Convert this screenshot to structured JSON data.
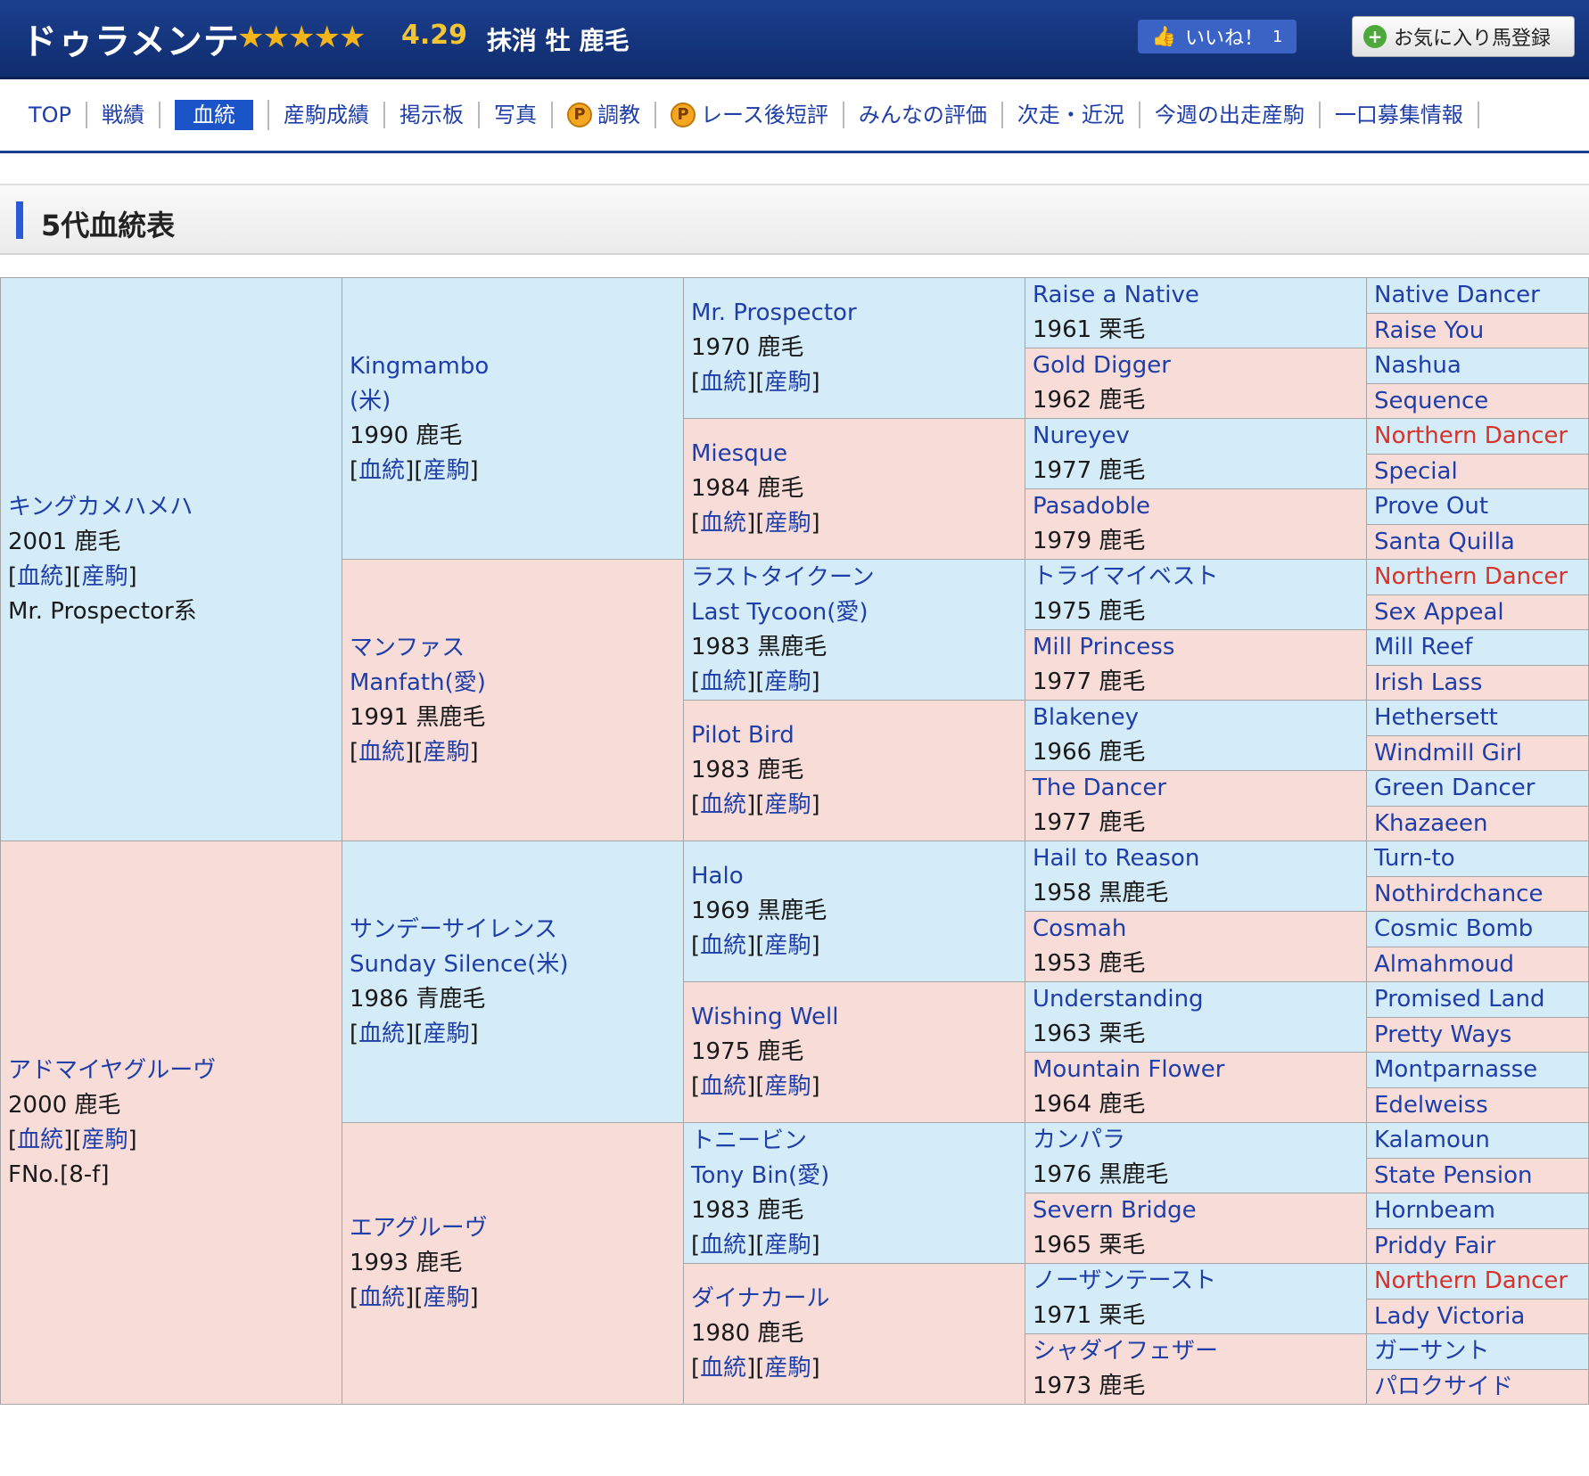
{
  "header": {
    "horse_name": "ドゥラメンテ",
    "stars": "★★★★★",
    "rating": "4.29",
    "info": "抹消 牡 鹿毛",
    "like_label": "いいね！",
    "like_count": "1",
    "favorite_label": "お気に入り馬登録"
  },
  "nav": {
    "items": [
      "TOP",
      "戦績",
      "血統",
      "産駒成績",
      "掲示板",
      "写真",
      "調教",
      "レース後短評",
      "みんなの評価",
      "次走・近況",
      "今週の出走産駒",
      "一口募集情報"
    ],
    "active": "血統"
  },
  "section": {
    "title": "5代血統表"
  },
  "links": {
    "pedigree": "血統",
    "progeny": "産駒"
  },
  "pedigree": {
    "sire": {
      "name": "キングカメハメハ",
      "info": "2001 鹿毛",
      "line": "Mr. Prospector系"
    },
    "dam": {
      "name": "アドマイヤグルーヴ",
      "info": "2000 鹿毛",
      "line": "FNo.[8-f]"
    },
    "g2": [
      {
        "name": "Kingmambo",
        "name2": "(米)",
        "info": "1990 鹿毛"
      },
      {
        "name": "マンファス",
        "name2": "Manfath(愛)",
        "info": "1991 黒鹿毛"
      },
      {
        "name": "サンデーサイレンス",
        "name2": "Sunday Silence(米)",
        "info": "1986 青鹿毛"
      },
      {
        "name": "エアグルーヴ",
        "name2": "",
        "info": "1993 鹿毛"
      }
    ],
    "g3": [
      {
        "name": "Mr. Prospector",
        "name2": "",
        "info": "1970 鹿毛"
      },
      {
        "name": "Miesque",
        "name2": "",
        "info": "1984 鹿毛"
      },
      {
        "name": "ラストタイクーン",
        "name2": "Last Tycoon(愛)",
        "info": "1983 黒鹿毛"
      },
      {
        "name": "Pilot Bird",
        "name2": "",
        "info": "1983 鹿毛"
      },
      {
        "name": "Halo",
        "name2": "",
        "info": "1969 黒鹿毛"
      },
      {
        "name": "Wishing Well",
        "name2": "",
        "info": "1975 鹿毛"
      },
      {
        "name": "トニービン",
        "name2": "Tony Bin(愛)",
        "info": "1983 鹿毛"
      },
      {
        "name": "ダイナカール",
        "name2": "",
        "info": "1980 鹿毛"
      }
    ],
    "g4": [
      {
        "name": "Raise a Native",
        "info": "1961 栗毛"
      },
      {
        "name": "Gold Digger",
        "info": "1962 鹿毛"
      },
      {
        "name": "Nureyev",
        "info": "1977 鹿毛"
      },
      {
        "name": "Pasadoble",
        "info": "1979 鹿毛"
      },
      {
        "name": "トライマイベスト",
        "info": "1975 鹿毛"
      },
      {
        "name": "Mill Princess",
        "info": "1977 鹿毛"
      },
      {
        "name": "Blakeney",
        "info": "1966 鹿毛"
      },
      {
        "name": "The Dancer",
        "info": "1977 鹿毛"
      },
      {
        "name": "Hail to Reason",
        "info": "1958 黒鹿毛"
      },
      {
        "name": "Cosmah",
        "info": "1953 鹿毛"
      },
      {
        "name": "Understanding",
        "info": "1963 栗毛"
      },
      {
        "name": "Mountain Flower",
        "info": "1964 鹿毛"
      },
      {
        "name": "カンパラ",
        "info": "1976 黒鹿毛"
      },
      {
        "name": "Severn Bridge",
        "info": "1965 栗毛"
      },
      {
        "name": "ノーザンテースト",
        "info": "1971 栗毛"
      },
      {
        "name": "シャダイフェザー",
        "info": "1973 鹿毛"
      }
    ],
    "g5": [
      "Native Dancer",
      "Raise You",
      "Nashua",
      "Sequence",
      "Northern Dancer",
      "Special",
      "Prove Out",
      "Santa Quilla",
      "Northern Dancer",
      "Sex Appeal",
      "Mill Reef",
      "Irish Lass",
      "Hethersett",
      "Windmill Girl",
      "Green Dancer",
      "Khazaeen",
      "Turn-to",
      "Nothirdchance",
      "Cosmic Bomb",
      "Almahmoud",
      "Promised Land",
      "Pretty Ways",
      "Montparnasse",
      "Edelweiss",
      "Kalamoun",
      "State Pension",
      "Hornbeam",
      "Priddy Fair",
      "Northern Dancer",
      "Lady Victoria",
      "ガーサント",
      "パロクサイド"
    ]
  },
  "colors": {
    "sire_bg": "#d4ecf8",
    "dam_bg": "#f8dcd8",
    "link": "#1f3ea8",
    "highlight": "#d8322b",
    "header_bg": "#1c3f8e"
  }
}
